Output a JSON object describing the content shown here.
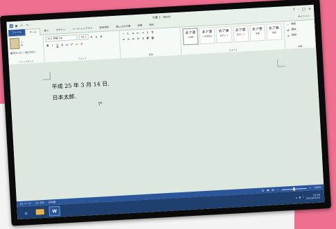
{
  "app": {
    "window_title": "文書 1 - Word",
    "sign_in": "サインイン"
  },
  "tabs": [
    "ファイル",
    "ホーム",
    "挿入",
    "デザイン",
    "ページ レイアウト",
    "参考資料",
    "差し込み文書",
    "校閲",
    "表示"
  ],
  "ribbon": {
    "clipboard": {
      "label": "クリップボード",
      "paste": "貼り付け",
      "format_painter": "書式のコピー/貼り付け"
    },
    "font": {
      "label": "フォント",
      "font_name": "ＭＳ 明朝 (本",
      "font_size": "10.5"
    },
    "paragraph": {
      "label": "段落"
    },
    "styles": {
      "label": "スタイル",
      "items": [
        {
          "sample": "あア亜",
          "name": "↵標準"
        },
        {
          "sample": "あア亜",
          "name": "↵行間詰め"
        },
        {
          "sample": "あア亜",
          "name": "見出し 1"
        },
        {
          "sample": "あア亜",
          "name": "見出し 2"
        },
        {
          "sample": "あア亜",
          "name": "表題"
        },
        {
          "sample": "あア亜",
          "name": "副題"
        }
      ]
    },
    "editing": {
      "label": "編集",
      "find": "検索",
      "replace": "置換",
      "select": "選択"
    }
  },
  "document": {
    "line1": "平成 25 年 3 月 14 日.",
    "line2": "日本太郎."
  },
  "statusbar": {
    "page_info": "1/1 ページ",
    "word_count": "11 文字",
    "language": "日本語",
    "zoom": "100%"
  },
  "taskbar": {
    "time": "15:29",
    "date": "2013/03/14"
  }
}
